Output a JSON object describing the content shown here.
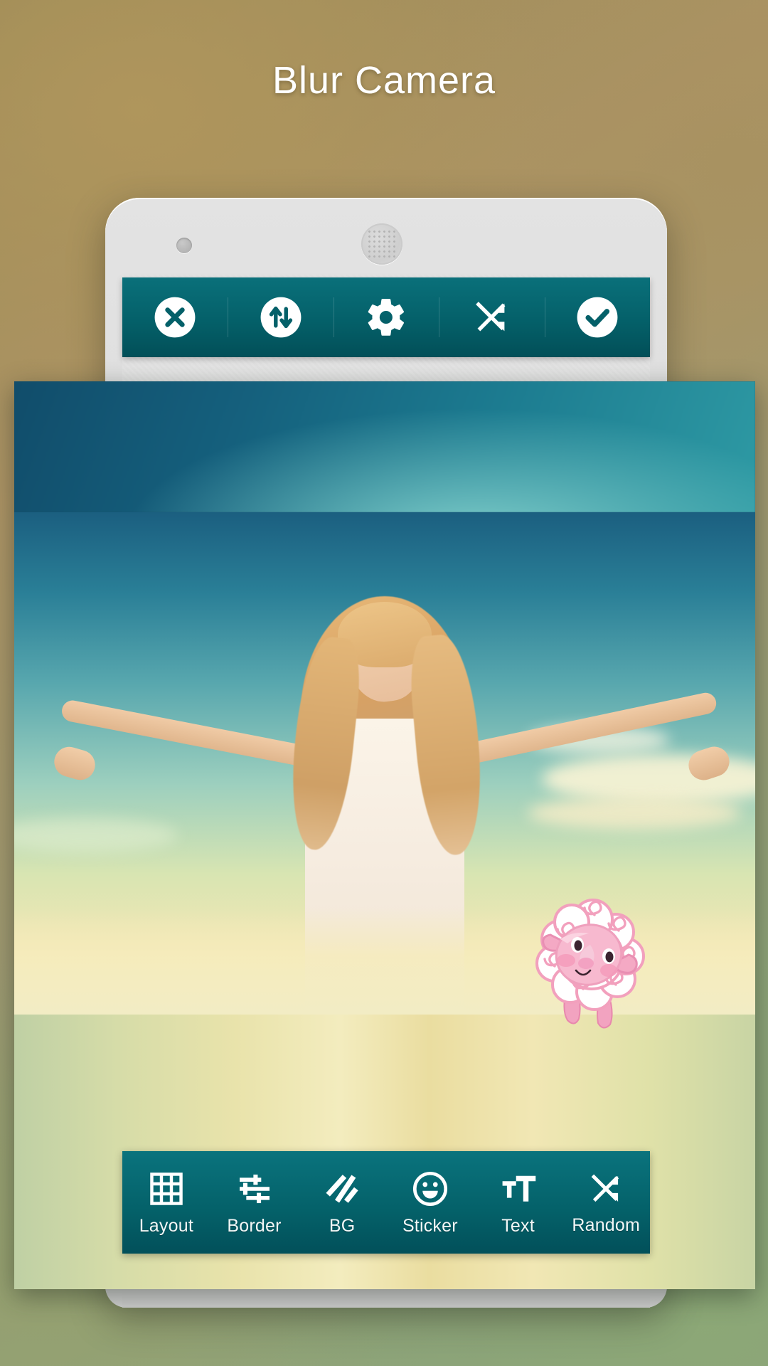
{
  "app": {
    "title": "Blur Camera",
    "accent_teal": "#046069",
    "toolbar_icon_color": "#ffffff",
    "background_colors": [
      "#ad9465",
      "#9e9a72",
      "#8aa07d"
    ]
  },
  "device": {
    "name": "android-phone-mockup",
    "front_camera": "camera-dot",
    "earpiece": "speaker-grille"
  },
  "top_toolbar": {
    "items": [
      {
        "id": "close",
        "icon": "close-circle-icon",
        "label": "Close"
      },
      {
        "id": "swap",
        "icon": "swap-vertical-circle-icon",
        "label": "Swap"
      },
      {
        "id": "settings",
        "icon": "gear-icon",
        "label": "Settings"
      },
      {
        "id": "shuffle",
        "icon": "shuffle-icon",
        "label": "Shuffle"
      },
      {
        "id": "confirm",
        "icon": "check-circle-icon",
        "label": "Confirm"
      }
    ]
  },
  "bottom_toolbar": {
    "items": [
      {
        "id": "layout",
        "icon": "grid-icon",
        "label": "Layout"
      },
      {
        "id": "border",
        "icon": "sliders-icon",
        "label": "Border"
      },
      {
        "id": "bg",
        "icon": "diagonal-stripes-icon",
        "label": "BG"
      },
      {
        "id": "sticker",
        "icon": "smiley-icon",
        "label": "Sticker"
      },
      {
        "id": "text",
        "icon": "text-size-icon",
        "label": "Text"
      },
      {
        "id": "random",
        "icon": "shuffle-icon",
        "label": "Random"
      }
    ]
  },
  "collage": {
    "name": "photo-collage-preview",
    "background_style": "blurred-photo-bands",
    "photo_subject": "young girl with long blonde hair arms outstretched against sky",
    "sticker": {
      "name": "sheep-sticker",
      "colors": {
        "body": "#ffffff",
        "outline": "#f2a0bd",
        "face": "#f7b9cf"
      }
    }
  }
}
